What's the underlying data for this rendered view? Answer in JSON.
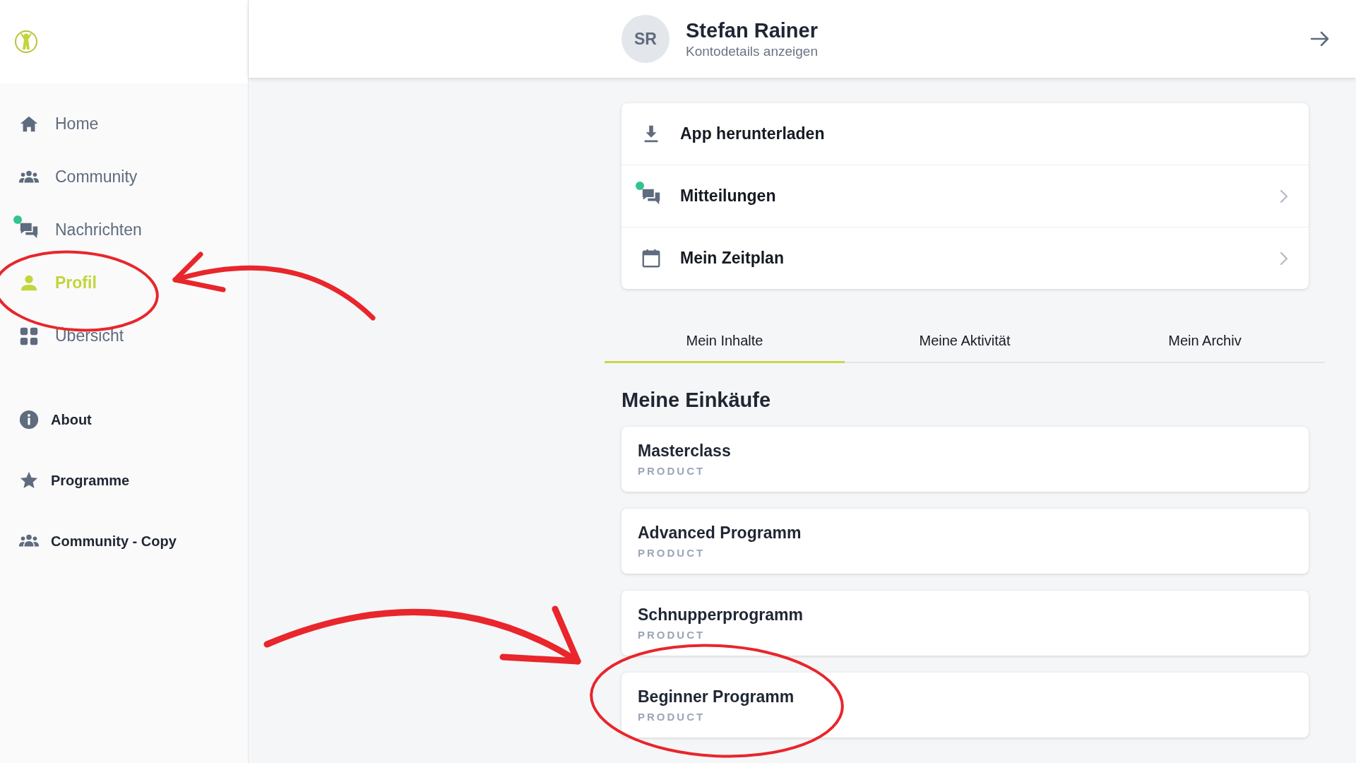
{
  "sidebar": {
    "items": [
      {
        "label": "Home",
        "selected": false,
        "unread": false
      },
      {
        "label": "Community",
        "selected": false,
        "unread": false
      },
      {
        "label": "Nachrichten",
        "selected": false,
        "unread": true
      },
      {
        "label": "Profil",
        "selected": true,
        "unread": false
      },
      {
        "label": "Übersicht",
        "selected": false,
        "unread": false
      }
    ],
    "links": [
      {
        "label": "About"
      },
      {
        "label": "Programme"
      },
      {
        "label": "Community - Copy"
      }
    ]
  },
  "header": {
    "initials": "SR",
    "name": "Stefan Rainer",
    "subtitle": "Kontodetails anzeigen"
  },
  "menu": [
    {
      "label": "App herunterladen",
      "unread": false,
      "chevron": false
    },
    {
      "label": "Mitteilungen",
      "unread": true,
      "chevron": true
    },
    {
      "label": "Mein Zeitplan",
      "unread": false,
      "chevron": true
    }
  ],
  "tabs": [
    {
      "label": "Mein Inhalte",
      "selected": true
    },
    {
      "label": "Meine Aktivität",
      "selected": false
    },
    {
      "label": "Mein Archiv",
      "selected": false
    }
  ],
  "section_title": "Meine Einkäufe",
  "purchases": [
    {
      "title": "Masterclass",
      "type": "PRODUCT"
    },
    {
      "title": "Advanced Programm",
      "type": "PRODUCT"
    },
    {
      "title": "Schnupperprogramm",
      "type": "PRODUCT"
    },
    {
      "title": "Beginner Programm",
      "type": "PRODUCT"
    }
  ]
}
